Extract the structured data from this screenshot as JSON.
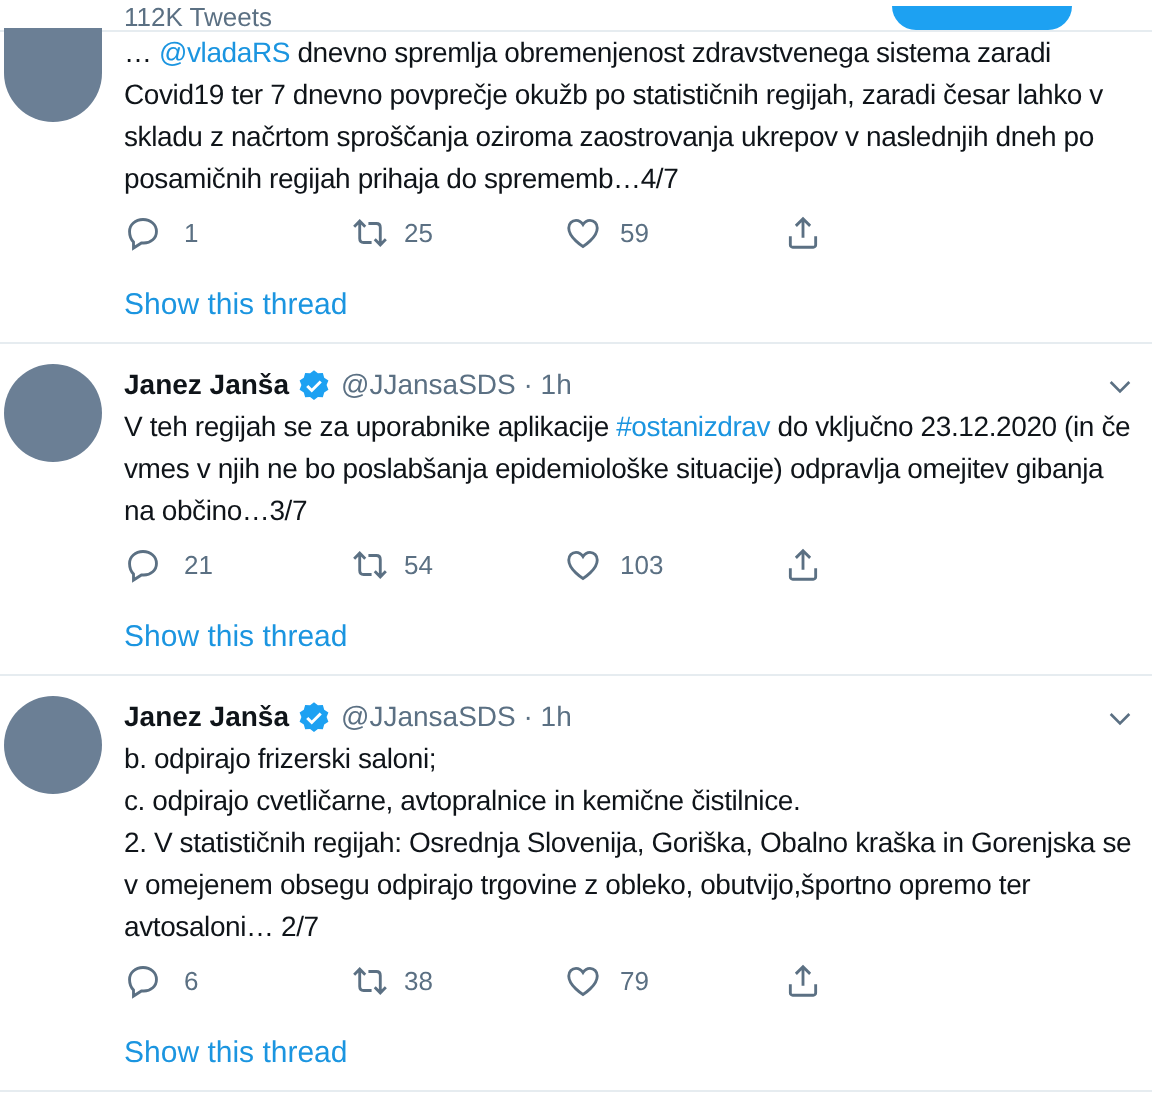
{
  "header": {
    "tweet_count": "112K Tweets"
  },
  "tweets": [
    {
      "body": [
        {
          "kind": "plain",
          "text": "… "
        },
        {
          "kind": "link",
          "text": "@vladaRS"
        },
        {
          "kind": "plain",
          "text": " dnevno spremlja obremenjenost zdravstvenega sistema zaradi Covid19 ter 7 dnevno povprečje okužb po statističnih regijah, zaradi česar lahko v skladu z načrtom sproščanja oziroma zaostrovanja ukrepov v naslednjih dneh po posamičnih regijah prihaja do sprememb…4/7"
        }
      ],
      "replies": "1",
      "retweets": "25",
      "likes": "59",
      "show_thread": "Show this thread"
    },
    {
      "author": "Janez Janša",
      "handle": "@JJansaSDS · 1h",
      "verified": true,
      "body": [
        {
          "kind": "plain",
          "text": "V teh regijah se za uporabnike aplikacije "
        },
        {
          "kind": "link",
          "text": "#ostanizdrav"
        },
        {
          "kind": "plain",
          "text": "  do vključno 23.12.2020  (in če vmes v njih ne bo poslabšanja epidemiološke situacije) odpravlja omejitev gibanja na občino…3/7"
        }
      ],
      "replies": "21",
      "retweets": "54",
      "likes": "103",
      "show_thread": "Show this thread"
    },
    {
      "author": "Janez Janša",
      "handle": "@JJansaSDS · 1h",
      "verified": true,
      "body": [
        {
          "kind": "plain",
          "text": "b. odpirajo frizerski saloni;\nc. odpirajo cvetličarne, avtopralnice in kemične čistilnice.\n2. V statističnih regijah: Osrednja Slovenija, Goriška, Obalno kraška in Gorenjska se v omejenem obsegu odpirajo trgovine z obleko, obutvijo,športno opremo ter avtosaloni… 2/7"
        }
      ],
      "replies": "6",
      "retweets": "38",
      "likes": "79",
      "show_thread": "Show this thread"
    }
  ]
}
